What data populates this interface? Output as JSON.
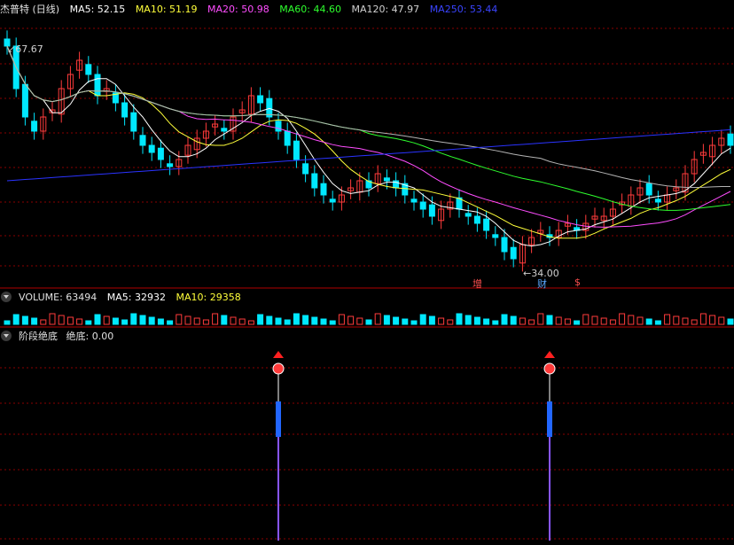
{
  "colors": {
    "up": "#ff3b3b",
    "down": "#00e8ff",
    "ma5": "#ffffff",
    "ma10": "#ffff3a",
    "ma20": "#ff4dff",
    "ma60": "#2eff2e",
    "ma120": "#b4b4b4",
    "ma250": "#2a33ff",
    "grid": "#8a0000",
    "sep": "#b00000"
  },
  "main": {
    "title": "杰普特 (日线)",
    "ma5": "MA5: 52.15",
    "ma10": "MA10: 51.19",
    "ma20": "MA20: 50.98",
    "ma60": "MA60: 44.60",
    "ma120": "MA120: 47.97",
    "ma250": "MA250: 53.44",
    "high_label": "67.67",
    "low_label": "34.00",
    "tags": [
      "增",
      "财",
      "$"
    ]
  },
  "volume": {
    "title": "VOLUME: 63494",
    "ma5": "MA5: 32932",
    "ma10": "MA10: 29358"
  },
  "indicator": {
    "title": "阶段绝底",
    "value": "绝底: 0.00",
    "signals": [
      {
        "index": 30
      },
      {
        "index": 60
      }
    ]
  },
  "chart_data": {
    "type": "candlestick",
    "closes": [
      64,
      58,
      54,
      52,
      54,
      55,
      58,
      60,
      62,
      60,
      57,
      58,
      56,
      54,
      52,
      50,
      49,
      48,
      47,
      48,
      50,
      51,
      52,
      53,
      52,
      54,
      55,
      57,
      56,
      54,
      52,
      50,
      48,
      46,
      44,
      43,
      42,
      43,
      44,
      45,
      44,
      46,
      45,
      44,
      43,
      42,
      41,
      40,
      41,
      42,
      41,
      40,
      39,
      38,
      37,
      35,
      34,
      36,
      37,
      38,
      37,
      38,
      39,
      38,
      39,
      40,
      40,
      41,
      42,
      43,
      44,
      43,
      42,
      43,
      44,
      46,
      48,
      49,
      50,
      51,
      50
    ]
  }
}
